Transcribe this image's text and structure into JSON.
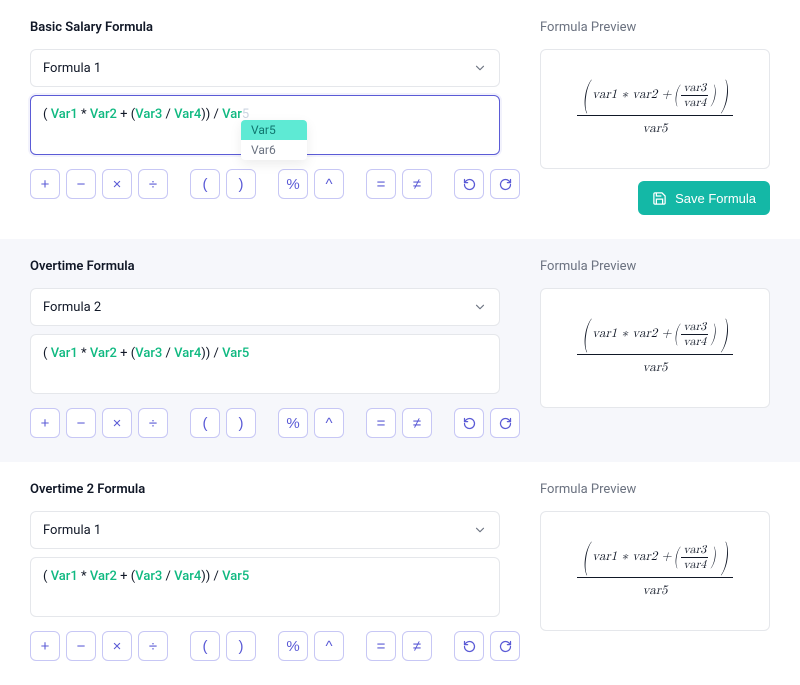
{
  "operators": {
    "plus": "+",
    "minus": "−",
    "multiply": "×",
    "divide": "÷",
    "lparen": "(",
    "rparen": ")",
    "percent": "%",
    "power": "^",
    "equals": "=",
    "neq": "≠",
    "undo": "↺",
    "redo": "↻"
  },
  "preview_math": {
    "var1": "var",
    "n1": "1",
    "var2": "var",
    "n2": "2",
    "var3": "var",
    "n3": "3",
    "var4": "var",
    "n4": "4",
    "var5": "var",
    "n5": "5",
    "star": " ∗ ",
    "plus": " + "
  },
  "sections": [
    {
      "id": "basic",
      "title": "Basic Salary Formula",
      "preview_label": "Formula Preview",
      "dropdown_value": "Formula 1",
      "alt_bg": false,
      "has_autocomplete": true,
      "has_save": true,
      "focused": true,
      "save_label": "Save Formula",
      "autocomplete": {
        "options": [
          "Var5",
          "Var6"
        ],
        "selected_index": 0
      },
      "tokens": [
        {
          "t": "paren",
          "v": "( "
        },
        {
          "t": "var",
          "v": "Var1"
        },
        {
          "t": "op",
          "v": " * "
        },
        {
          "t": "var",
          "v": "Var2"
        },
        {
          "t": "op",
          "v": " + "
        },
        {
          "t": "paren",
          "v": "("
        },
        {
          "t": "var",
          "v": "Var3"
        },
        {
          "t": "op",
          "v": " / "
        },
        {
          "t": "var",
          "v": "Var4"
        },
        {
          "t": "paren",
          "v": ")"
        },
        {
          "t": "paren",
          "v": ") "
        },
        {
          "t": "op",
          "v": "/ "
        },
        {
          "t": "partial",
          "v": "Var"
        },
        {
          "t": "hint",
          "v": "5"
        }
      ]
    },
    {
      "id": "overtime",
      "title": "Overtime Formula",
      "preview_label": "Formula Preview",
      "dropdown_value": "Formula 2",
      "alt_bg": true,
      "has_autocomplete": false,
      "has_save": false,
      "focused": false,
      "tokens": [
        {
          "t": "paren",
          "v": "( "
        },
        {
          "t": "var",
          "v": "Var1"
        },
        {
          "t": "op",
          "v": " * "
        },
        {
          "t": "var",
          "v": "Var2"
        },
        {
          "t": "op",
          "v": " + "
        },
        {
          "t": "paren",
          "v": "("
        },
        {
          "t": "var",
          "v": "Var3"
        },
        {
          "t": "op",
          "v": " / "
        },
        {
          "t": "var",
          "v": "Var4"
        },
        {
          "t": "paren",
          "v": ")"
        },
        {
          "t": "paren",
          "v": ") "
        },
        {
          "t": "op",
          "v": "/ "
        },
        {
          "t": "var",
          "v": "Var5"
        }
      ]
    },
    {
      "id": "overtime2",
      "title": "Overtime 2 Formula",
      "preview_label": "Formula Preview",
      "dropdown_value": "Formula 1",
      "alt_bg": false,
      "has_autocomplete": false,
      "has_save": false,
      "focused": false,
      "tokens": [
        {
          "t": "paren",
          "v": "( "
        },
        {
          "t": "var",
          "v": "Var1"
        },
        {
          "t": "op",
          "v": " * "
        },
        {
          "t": "var",
          "v": "Var2"
        },
        {
          "t": "op",
          "v": " + "
        },
        {
          "t": "paren",
          "v": "("
        },
        {
          "t": "var",
          "v": "Var3"
        },
        {
          "t": "op",
          "v": " / "
        },
        {
          "t": "var",
          "v": "Var4"
        },
        {
          "t": "paren",
          "v": ")"
        },
        {
          "t": "paren",
          "v": ") "
        },
        {
          "t": "op",
          "v": "/ "
        },
        {
          "t": "var",
          "v": "Var5"
        }
      ]
    }
  ]
}
